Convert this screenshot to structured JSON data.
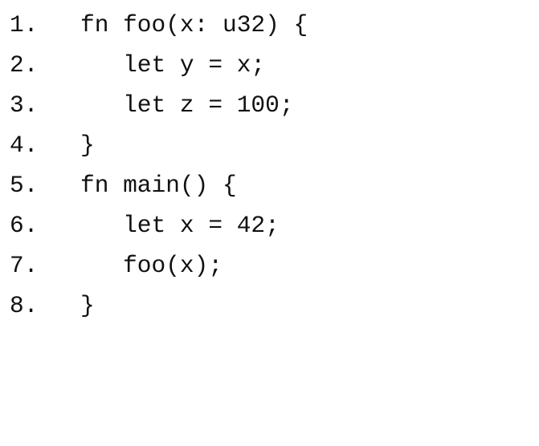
{
  "code": {
    "lines": [
      {
        "number": "1.",
        "text": "fn foo(x: u32) {"
      },
      {
        "number": "2.",
        "text": "   let y = x;"
      },
      {
        "number": "3.",
        "text": "   let z = 100;"
      },
      {
        "number": "4.",
        "text": "}"
      },
      {
        "number": "5.",
        "text": "fn main() {"
      },
      {
        "number": "6.",
        "text": "   let x = 42;"
      },
      {
        "number": "7.",
        "text": "   foo(x);"
      },
      {
        "number": "8.",
        "text": "}"
      }
    ]
  }
}
